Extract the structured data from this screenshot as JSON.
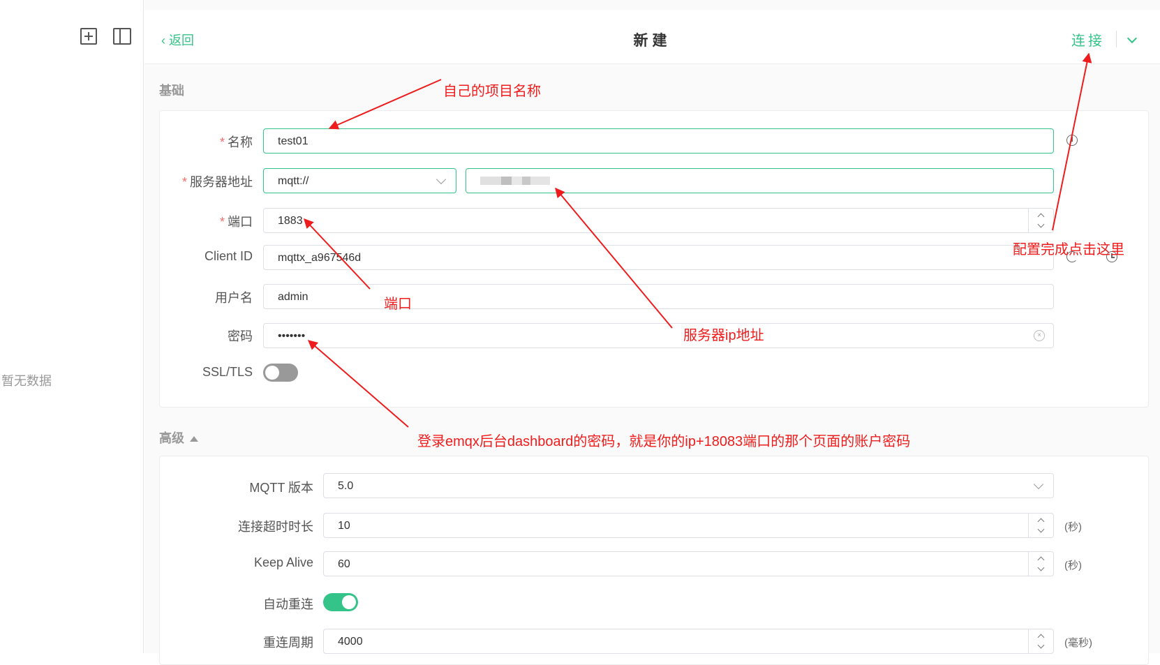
{
  "sidebar": {
    "new_icon": "plus-square-icon",
    "panel_icon": "sidebar-panel-icon",
    "empty_text": "暂无数据"
  },
  "header": {
    "back_label": "返回",
    "title": "新建",
    "connect_label": "连接",
    "dropdown_icon": "chevron-down-icon"
  },
  "basic": {
    "section_title": "基础",
    "name_label": "名称",
    "name_value": "test01",
    "host_label": "服务器地址",
    "protocol_value": "mqtt://",
    "port_label": "端口",
    "port_value": "1883",
    "client_id_label": "Client ID",
    "client_id_value": "mqttx_a967546d",
    "username_label": "用户名",
    "username_value": "admin",
    "password_label": "密码",
    "password_value": "•••••••",
    "ssl_label": "SSL/TLS",
    "ssl_enabled": false
  },
  "advanced": {
    "section_title": "高级",
    "mqtt_version_label": "MQTT 版本",
    "mqtt_version_value": "5.0",
    "connect_timeout_label": "连接超时时长",
    "connect_timeout_value": "10",
    "connect_timeout_unit": "(秒)",
    "keep_alive_label": "Keep Alive",
    "keep_alive_value": "60",
    "keep_alive_unit": "(秒)",
    "auto_reconnect_label": "自动重连",
    "auto_reconnect_enabled": true,
    "reconnect_period_label": "重连周期",
    "reconnect_period_value": "4000",
    "reconnect_period_unit": "(毫秒)"
  },
  "annotations": {
    "name_note": "自己的项目名称",
    "connect_note": "配置完成点击这里",
    "port_note": "端口",
    "host_note": "服务器ip地址",
    "password_note": "登录emqx后台dashboard的密码，就是你的ip+18083端口的那个页面的账户密码"
  },
  "colors": {
    "accent": "#34c388",
    "annotation": "#ee1c1c",
    "required": "#f56c6c"
  }
}
